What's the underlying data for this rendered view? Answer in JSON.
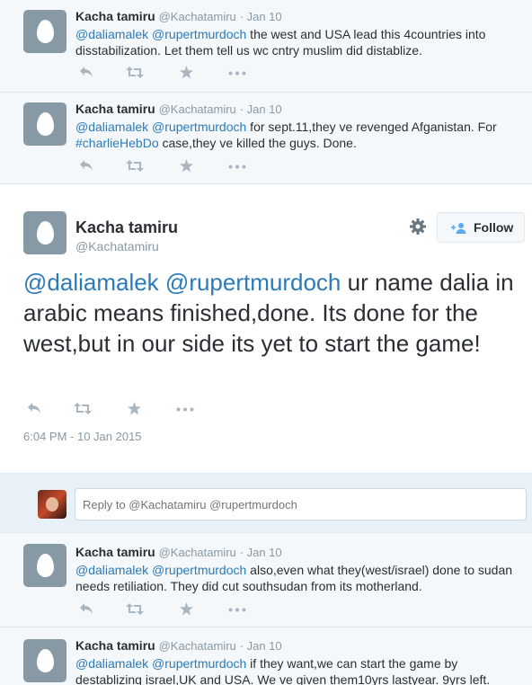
{
  "tweets_before": [
    {
      "name": "Kacha tamiru",
      "handle": "@Kachatamiru",
      "time": "· Jan 10",
      "mention1": "@daliamalek",
      "mention2": "@rupertmurdoch",
      "line1_rest": " the west and USA lead this 4countries into",
      "line2": "disstabilization. Let them tell us wc cntry muslim did distablize."
    },
    {
      "name": "Kacha tamiru",
      "handle": "@Kachatamiru",
      "time": "· Jan 10",
      "mention1": "@daliamalek",
      "mention2": "@rupertmurdoch",
      "line1_rest": " for sept.11,they ve revenged Afganistan. For",
      "hashtag": "#charlieHebDo",
      "line2_rest": " case,they ve killed the guys. Done."
    }
  ],
  "main_tweet": {
    "name": "Kacha tamiru",
    "handle": "@Kachatamiru",
    "follow_label": "Follow",
    "mention1": "@daliamalek",
    "mention2": "@rupertmurdoch",
    "text_rest": " ur name dalia in arabic means finished,done. Its done for the west,but in our side its yet to start the game!",
    "timestamp": "6:04 PM - 10 Jan 2015"
  },
  "reply": {
    "placeholder": "Reply to @Kachatamiru @rupertmurdoch"
  },
  "tweets_after": [
    {
      "name": "Kacha tamiru",
      "handle": "@Kachatamiru",
      "time": "· Jan 10",
      "mention1": "@daliamalek",
      "mention2": "@rupertmurdoch",
      "line1_rest": " also,even what they(west/israel) done to sudan",
      "line2": "needs retiliation. They did cut southsudan from its motherland."
    },
    {
      "name": "Kacha tamiru",
      "handle": "@Kachatamiru",
      "time": "· Jan 10",
      "mention1": "@daliamalek",
      "mention2": "@rupertmurdoch",
      "line1_rest": " if they want,we can start the game by",
      "line2": "destablizing israel,UK and USA. We ve given them10yrs lastyear. 9yrs left."
    }
  ],
  "icons": {
    "reply": "reply-icon",
    "retweet": "retweet-icon",
    "favorite": "star-icon",
    "more": "more-icon",
    "gear": "gear-icon",
    "follow": "follow-person-icon"
  },
  "colors": {
    "link": "#2b7bb9",
    "action_gray": "#a8b6c2",
    "muted": "#8899a6"
  }
}
